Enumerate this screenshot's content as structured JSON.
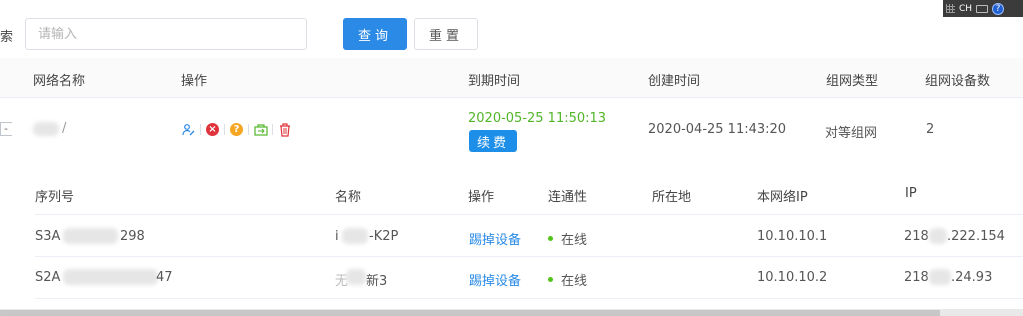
{
  "search": {
    "label": "索",
    "placeholder": "请输入",
    "query_label": "查询",
    "reset_label": "重置"
  },
  "tray": {
    "lang": "CH",
    "help": "?"
  },
  "table": {
    "columns": [
      "网络名称",
      "操作",
      "到期时间",
      "创建时间",
      "组网类型",
      "组网设备数"
    ],
    "row": {
      "expand": "-",
      "name_suffix": "/",
      "expire_time": "2020-05-25 11:50:13",
      "renew_label": "续费",
      "create_time": "2020-04-25 11:43:20",
      "network_type": "对等组网",
      "device_count": "2",
      "op_icons": [
        "user-edit-icon",
        "delete-circle-icon",
        "help-circle-icon",
        "transfer-icon",
        "trash-icon"
      ]
    }
  },
  "devices": {
    "columns": [
      "序列号",
      "名称",
      "操作",
      "连通性",
      "所在地",
      "本网络IP",
      "IP"
    ],
    "rows": [
      {
        "serial_prefix": "S3A",
        "serial_suffix": "298",
        "name_prefix": "i",
        "name_suffix": "-K2P",
        "action": "踢掉设备",
        "status": "在线",
        "location": "",
        "net_ip": "10.10.10.1",
        "ip_prefix": "218",
        "ip_suffix": ".222.154"
      },
      {
        "serial_prefix": "S2A",
        "serial_suffix": "47",
        "name_prefix": "无",
        "name_suffix": "新3",
        "action": "踢掉设备",
        "status": "在线",
        "location": "",
        "net_ip": "10.10.10.2",
        "ip_prefix": "218",
        "ip_suffix": ".24.93"
      }
    ]
  },
  "colors": {
    "primary": "#2a8ae6",
    "expire_green": "#52b629",
    "online_green": "#52c41a",
    "delete_red": "#e0333b",
    "help_orange": "#f5a623"
  }
}
